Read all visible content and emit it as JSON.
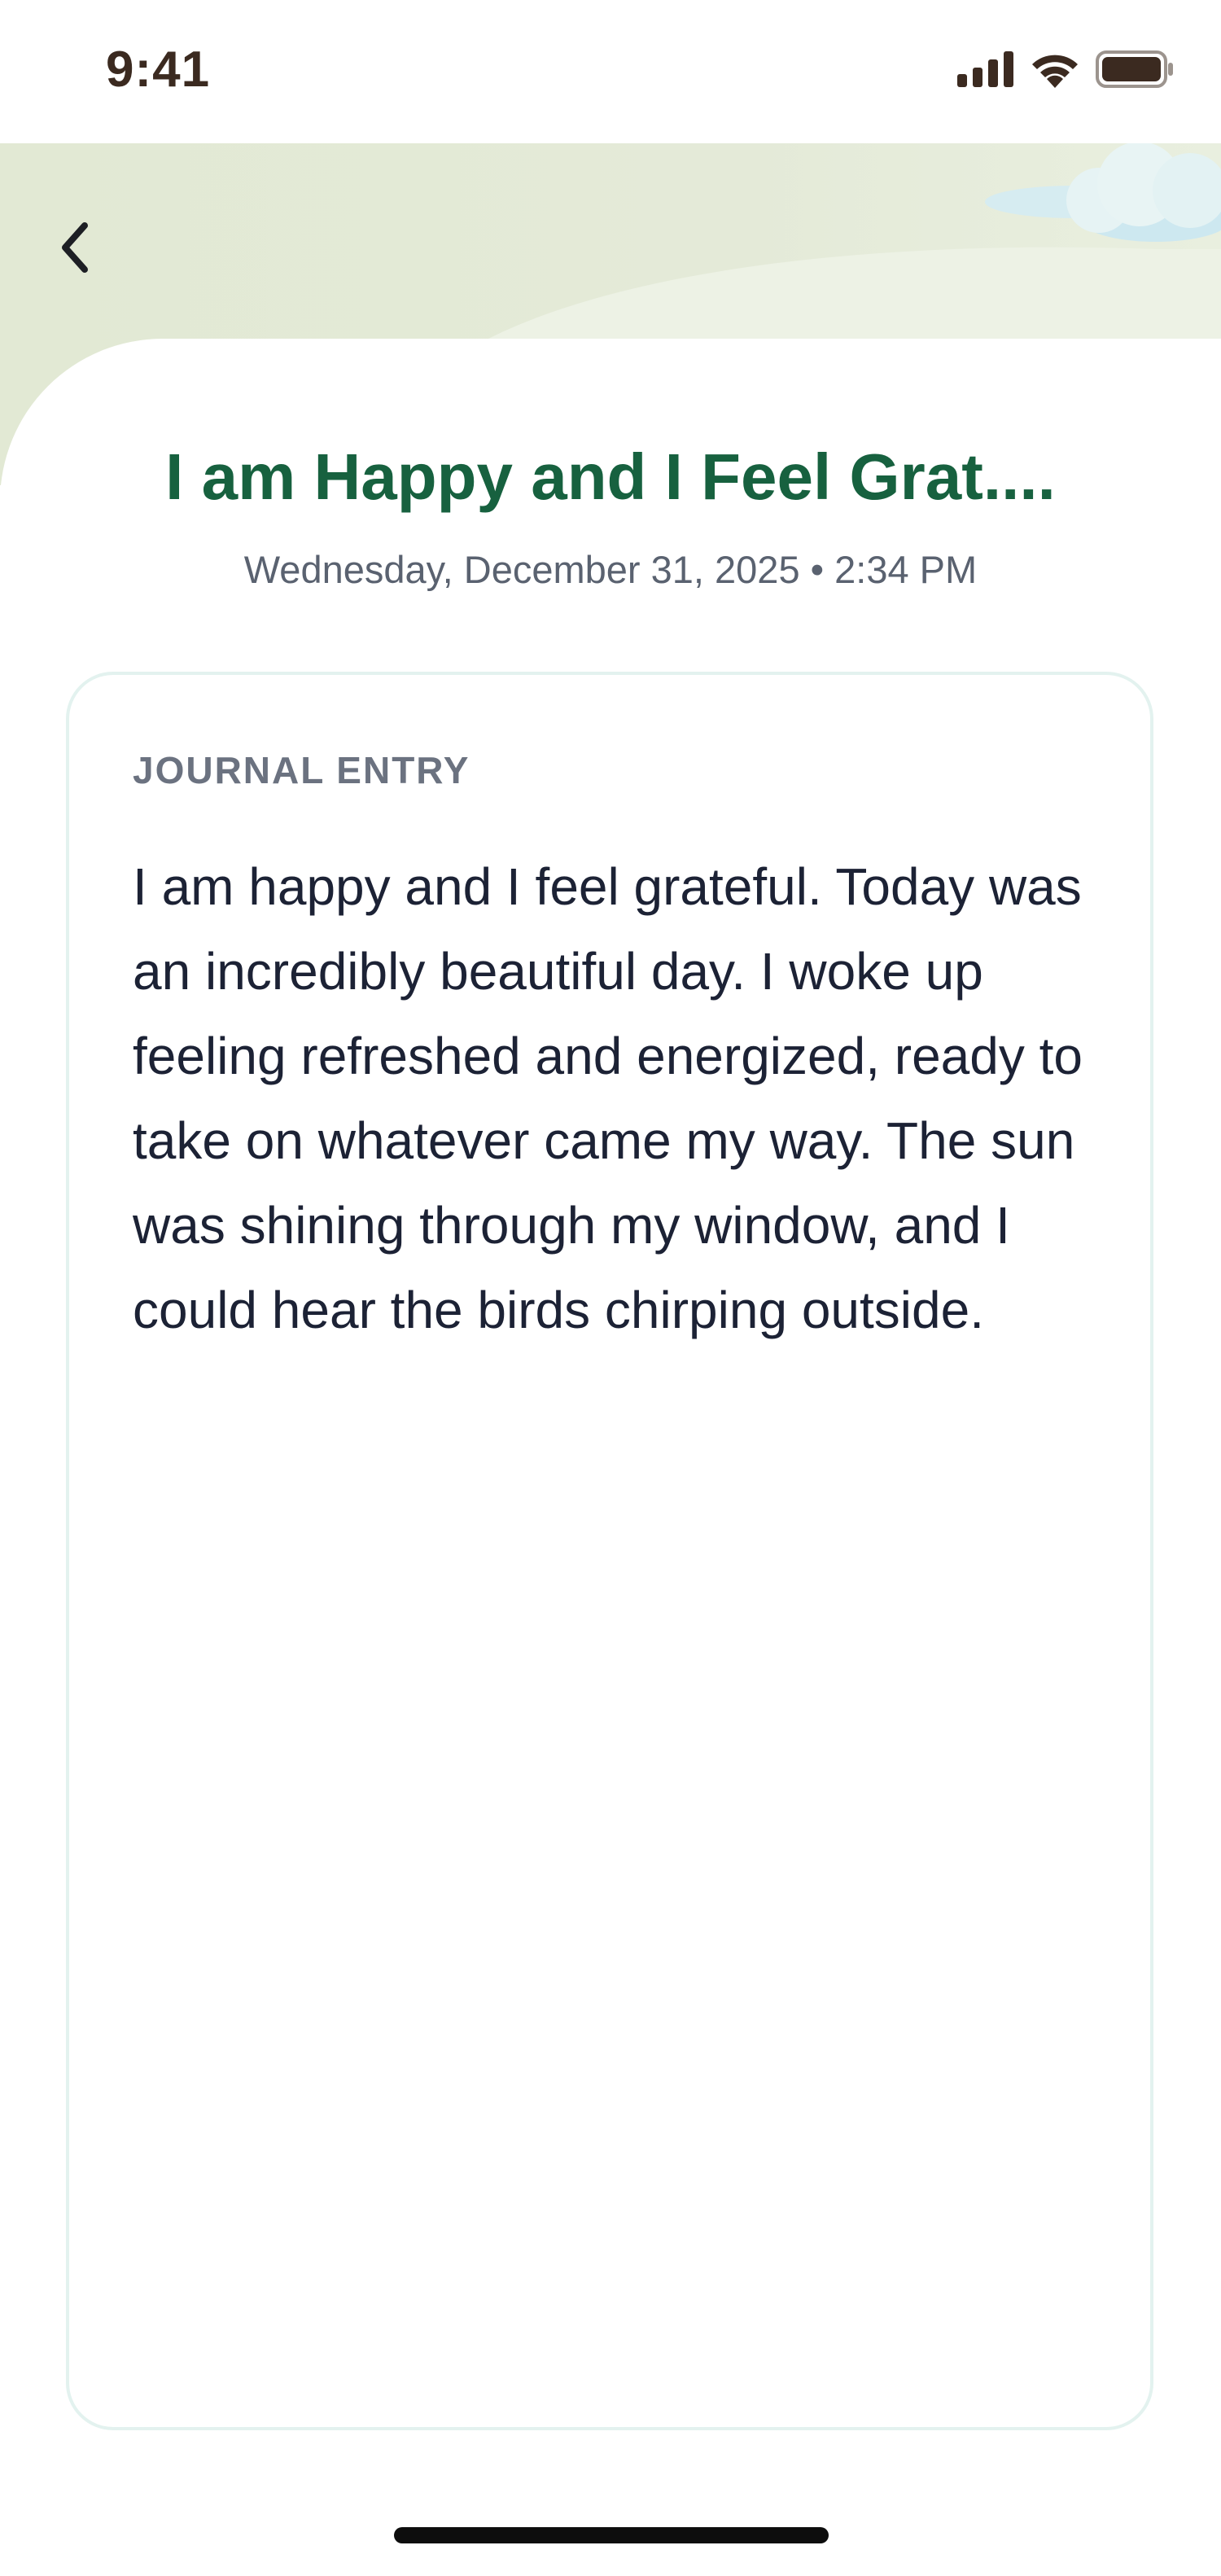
{
  "status_bar": {
    "time": "9:41",
    "icons": [
      "cellular-signal-icon",
      "wifi-icon",
      "battery-icon"
    ]
  },
  "header": {
    "back_icon": "chevron-left-icon",
    "decoration": "cloud-icon"
  },
  "entry": {
    "title": "I am Happy and I Feel Grat....",
    "datetime": "Wednesday, December 31, 2025 • 2:34 PM",
    "section_label": "JOURNAL ENTRY",
    "body": "I am happy and I feel grateful. Today was an incredibly beautiful day. I woke up feeling refreshed and energized, ready to take on whatever came my way. The sun was shining through my window, and I could hear the birds chirping outside."
  },
  "colors": {
    "title_green": "#17613f",
    "header_tint": "#e4ead6",
    "card_border": "#e3f2ef",
    "body_text": "#1c2235",
    "status_icons": "#3b2a20"
  }
}
